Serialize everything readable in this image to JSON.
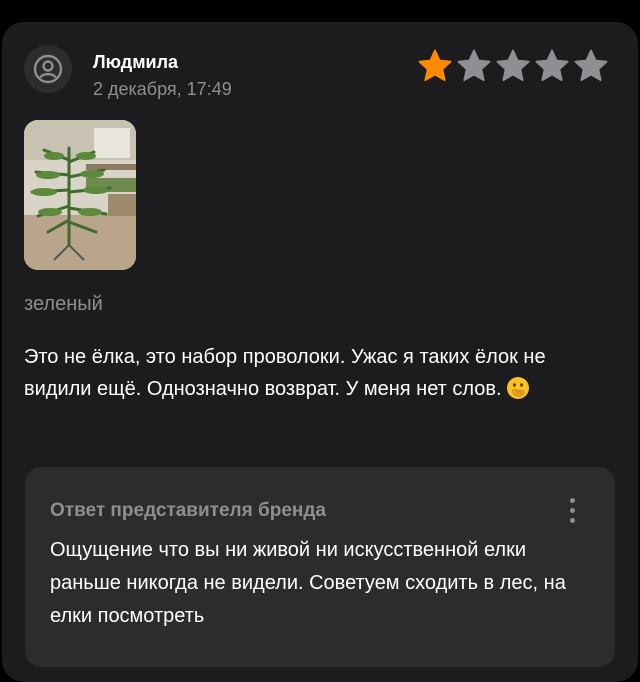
{
  "review": {
    "author": "Людмила",
    "date": "2 декабря, 17:49",
    "rating": 1,
    "max_rating": 5,
    "variant": "зеленый",
    "text": "Это не ёлка, это набор проволоки. Ужас я таких ёлок не видили ещё. Однозначно возврат. У меня нет слов."
  },
  "brand_reply": {
    "title": "Ответ представителя бренда",
    "text": "Ощущение что вы ни живой ни искусственной елки раньше никогда не видели. Советуем сходить в лес, на елки посмотреть"
  },
  "colors": {
    "background": "#000000",
    "card": "#1c1c1e",
    "reply_card": "#2c2c2e",
    "star_active": "#ff8a00",
    "star_inactive": "#8e8e93",
    "secondary_text": "#8e8e93"
  },
  "icons": {
    "avatar": "user-avatar-icon",
    "emoji": "face-with-hand-over-mouth-icon",
    "more": "more-vertical-icon"
  }
}
